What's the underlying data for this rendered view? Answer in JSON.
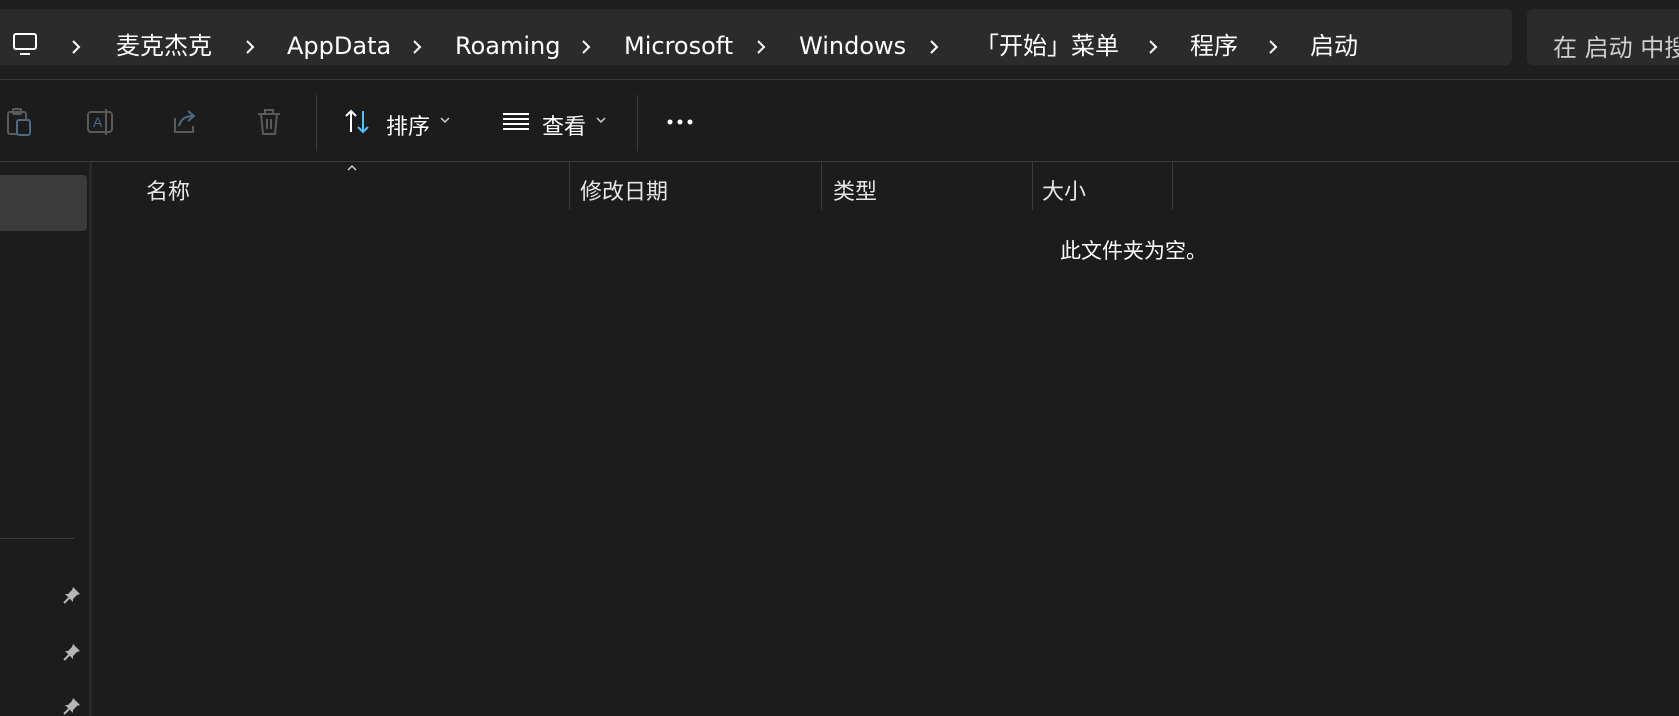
{
  "breadcrumb": {
    "items": [
      "麦克杰克",
      "AppData",
      "Roaming",
      "Microsoft",
      "Windows",
      "「开始」菜单",
      "程序",
      "启动"
    ]
  },
  "search": {
    "placeholder": "在 启动 中搜"
  },
  "toolbar": {
    "sort_label": "排序",
    "view_label": "查看",
    "icons": [
      "paste-icon",
      "rename-icon",
      "share-icon",
      "delete-icon",
      "sort-icon",
      "view-icon",
      "more-icon"
    ]
  },
  "columns": {
    "name": "名称",
    "modified": "修改日期",
    "type": "类型",
    "size": "大小"
  },
  "empty_message": "此文件夹为空。",
  "colors": {
    "background": "#1c1c1c",
    "accent": "#4cc2ff",
    "panel": "#2b2b2b"
  }
}
